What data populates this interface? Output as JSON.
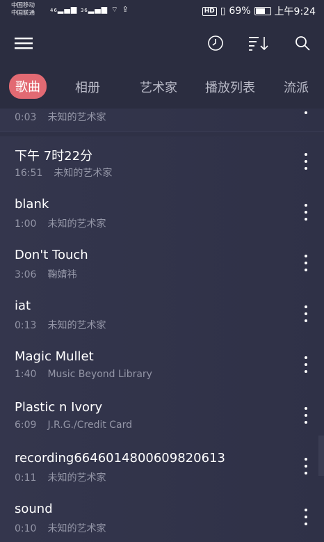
{
  "status_bar": {
    "carrier1": "中国移动",
    "carrier2": "中国联通",
    "signal1": "46",
    "signal2": "36",
    "hd": "HD",
    "battery": "69%",
    "battery_level": 0.69,
    "time": "上午9:24"
  },
  "appbar": {
    "icons": [
      "menu-icon",
      "clock-icon",
      "sort-icon",
      "search-icon"
    ]
  },
  "tabs": [
    {
      "label": "歌曲",
      "active": true
    },
    {
      "label": "相册",
      "active": false
    },
    {
      "label": "艺术家",
      "active": false
    },
    {
      "label": "播放列表",
      "active": false
    },
    {
      "label": "流派",
      "active": false
    }
  ],
  "songs": [
    {
      "title": "",
      "duration": "0:03",
      "artist": "未知的艺术家"
    },
    {
      "title": "下午 7时22分",
      "duration": "16:51",
      "artist": "未知的艺术家"
    },
    {
      "title": "blank",
      "duration": "1:00",
      "artist": "未知的艺术家"
    },
    {
      "title": "Don't Touch",
      "duration": "3:06",
      "artist": "鞠婧祎"
    },
    {
      "title": "iat",
      "duration": "0:13",
      "artist": "未知的艺术家"
    },
    {
      "title": "Magic Mullet",
      "duration": "1:40",
      "artist": "Music Beyond Library"
    },
    {
      "title": "Plastic n Ivory",
      "duration": "6:09",
      "artist": "J.R.G./Credit Card"
    },
    {
      "title": "recording6646014800609820613",
      "duration": "0:11",
      "artist": "未知的艺术家"
    },
    {
      "title": "sound",
      "duration": "0:10",
      "artist": "未知的艺术家"
    }
  ],
  "colors": {
    "accent": "#e26a73",
    "background": "#2f3146",
    "bar": "#2b2d40"
  }
}
